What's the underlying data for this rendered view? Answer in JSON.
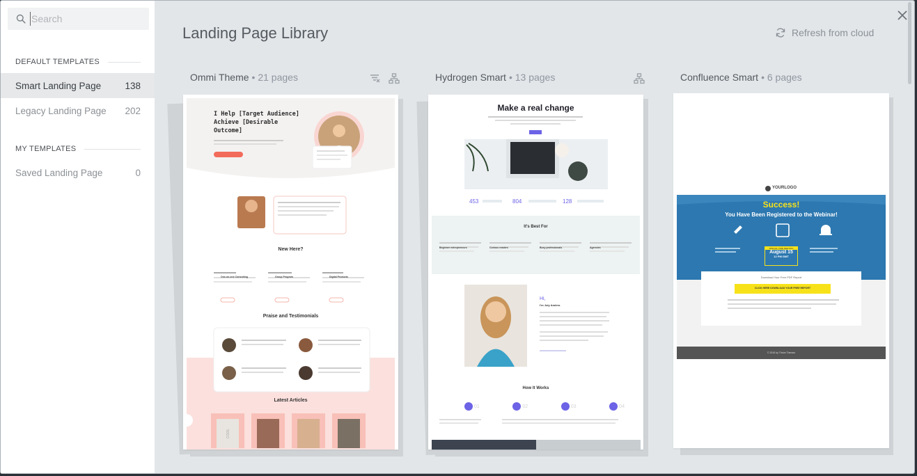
{
  "search": {
    "placeholder": "Search"
  },
  "page_title": "Landing Page Library",
  "refresh_label": "Refresh from cloud",
  "sidebar": {
    "default_header": "DEFAULT TEMPLATES",
    "my_header": "MY TEMPLATES",
    "items": [
      {
        "label": "Smart Landing Page",
        "count": "138"
      },
      {
        "label": "Legacy Landing Page",
        "count": "202"
      },
      {
        "label": "Saved Landing Page",
        "count": "0"
      }
    ]
  },
  "templates": [
    {
      "name": "Ommi Theme",
      "pages": "• 21 pages",
      "preview": {
        "hero_title": "I Help [Target Audience] Achieve [Desirable Outcome]",
        "new_here": "New Here?",
        "offer_1": "One-on-one Consulting",
        "offer_2": "Group Program",
        "offer_3": "Digital Products",
        "praise": "Praise and Testimonials",
        "articles": "Latest Articles",
        "vase_text": "COOL"
      }
    },
    {
      "name": "Hydrogen Smart",
      "pages": "• 13 pages",
      "preview": {
        "hero_title": "Make a real change",
        "stat_1": "453",
        "stat_2": "804",
        "stat_3": "128",
        "best_for": "It's Best For",
        "aud_1": "Beginner entrepreneurs",
        "aud_2": "Curious readers",
        "aud_3": "Busy professionals",
        "aud_4": "Agencies",
        "hi": "Hi,",
        "im": "I'm July Anders",
        "how": "How It Works",
        "step_1": "01",
        "step_2": "02",
        "step_3": "03",
        "step_4": "04"
      }
    },
    {
      "name": "Confluence Smart",
      "pages": "• 6 pages",
      "preview": {
        "logo": "YOURLOGO",
        "success": "Success!",
        "registered": "You Have Been Registered to the Webinar!",
        "date_label": "SPECIAL TIME MEETING",
        "date": "August 15",
        "time": "12 PM GMT",
        "download": "Download Your Free PDF Report",
        "cta": "CLICK HERE DOWNLOAD YOUR FREE REPORT",
        "footer": "© 2019 by Thrive Themes"
      }
    }
  ],
  "colors": {
    "accent_coral": "#f26b5b",
    "accent_purple": "#6c63e6",
    "accent_blue": "#2d78b0",
    "accent_yellow": "#f7e21a"
  }
}
